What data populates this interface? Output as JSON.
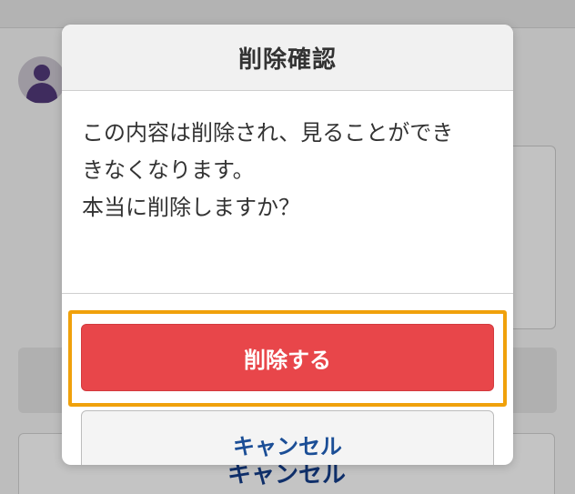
{
  "background": {
    "cancel_label": "キャンセル"
  },
  "dialog": {
    "title": "削除確認",
    "message_lines": [
      "この内容は削除され、見ることができ",
      "きなくなります。",
      "本当に削除しますか？"
    ],
    "confirm_label": "削除する",
    "cancel_label": "キャンセル"
  },
  "colors": {
    "confirm_button": "#e8464a",
    "cancel_text": "#1b4e96",
    "highlight_border": "#f0a10b"
  }
}
